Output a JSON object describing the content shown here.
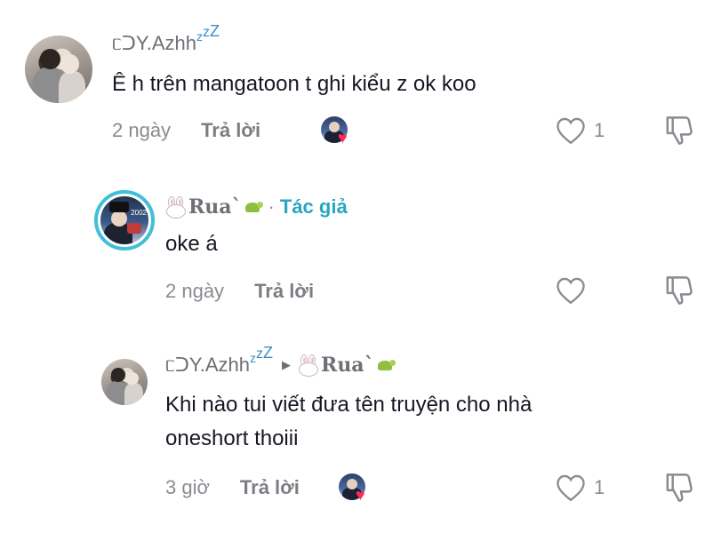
{
  "comments": [
    {
      "username": "ᥴᑐY.Azhh",
      "zz_small": "z",
      "zz_big": "z",
      "text": "Ê h trên mangatoon t ghi kiểu z ok koo",
      "time": "2 ngày",
      "reply_label": "Trả lời",
      "like_count": "1"
    },
    {
      "username_name": "Rua",
      "username_suffix": "`",
      "author_sep": "·",
      "author_tag": "Tác giả",
      "text": "oke á",
      "time": "2 ngày",
      "reply_label": "Trả lời"
    },
    {
      "username": "ᥴᑐY.Azhh",
      "zz_small": "z",
      "zz_big": "z",
      "reply_arrow": "▶",
      "reply_to_name": "Rua",
      "reply_to_suffix": "`",
      "text_line1": "Khi nào tui viết đưa tên truyện cho nhà",
      "text_line2": "oneshort thoiii",
      "time": "3 giờ",
      "reply_label": "Trả lời",
      "like_count": "1"
    }
  ],
  "icons": {
    "like": "heart-outline-icon",
    "dislike": "thumbs-down-icon",
    "creator_liked": "heart-filled-icon"
  },
  "colors": {
    "author_tag": "#2aa6c2",
    "author_ring": "#3fc0d6",
    "heart_red": "#fe2c55",
    "zz_blue": "#3c8ec8"
  }
}
